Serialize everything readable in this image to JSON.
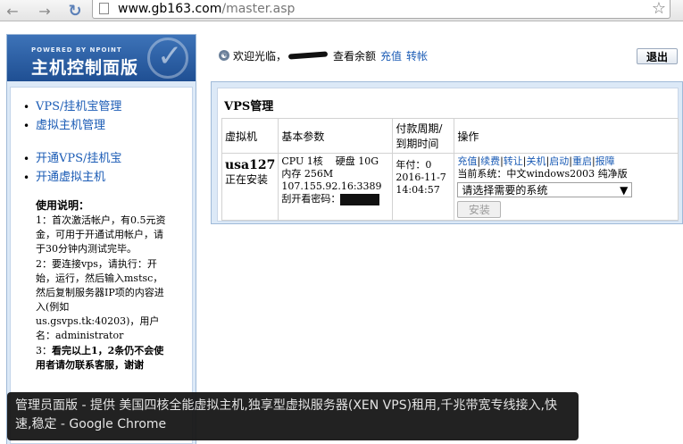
{
  "browser": {
    "url_host": "www.gb163.com",
    "url_path": "/master.asp",
    "back_icon": "back-arrow-icon",
    "forward_icon": "forward-arrow-icon",
    "reload_icon": "reload-icon",
    "star_icon": "bookmark-star-icon"
  },
  "logo": {
    "powered": "POWERED BY NPOINT",
    "title": "主机控制面版"
  },
  "sidebar": {
    "group1": [
      {
        "label": "VPS/挂机宝管理"
      },
      {
        "label": "虚拟主机管理"
      }
    ],
    "group2": [
      {
        "label": "开通VPS/挂机宝"
      },
      {
        "label": "开通虚拟主机"
      }
    ],
    "usage": {
      "title": "使用说明：",
      "item1": "1：首次激活帐户，有0.5元资金，可用于开通试用帐户，请于30分钟内测试完毕。",
      "item2": "2：要连接vps，请执行：开始，运行，然后输入mstsc，然后复制服务器IP项的内容进入(例如us.gsvps.tk:40203)，用户名：administrator",
      "item3_prefix": "3：",
      "item3_bold": "看完以上1，2条仍不会使用者请勿联系客服，谢谢"
    }
  },
  "header": {
    "welcome": "欢迎光临，",
    "check_balance": "查看余额",
    "recharge": "充值",
    "transfer": "转帐",
    "logout": "退出"
  },
  "main": {
    "title": "VPS管理",
    "columns": {
      "vm": "虚拟机",
      "spec": "基本参数",
      "pay_line1": "付款周期/",
      "pay_line2": "到期时间",
      "ops": "操作"
    },
    "row": {
      "name": "usa127",
      "status": "正在安装",
      "cpu": "CPU 1核    硬盘 10G",
      "mem": "内存 256M",
      "ip": "107.155.92.16:3389",
      "pw_label": "刮开看密码：",
      "pay": "年付：0",
      "expire_date": "2016-11-7",
      "expire_time": "14:04:57",
      "op_recharge": "充值",
      "op_renew": "续费",
      "op_transfer": "转让",
      "op_shutdown": "关机",
      "op_start": "启动",
      "op_restart": "重启",
      "op_report": "报障",
      "current_os": "当前系统：中文windows2003 纯净版",
      "os_select": "请选择需要的系统",
      "install": "安装"
    }
  },
  "tooltip": {
    "text": "管理员面版 - 提供 美国四核全能虚拟主机,独享型虚拟服务器(XEN VPS)租用,千兆带宽专线接入,快速,稳定 - Google Chrome"
  }
}
